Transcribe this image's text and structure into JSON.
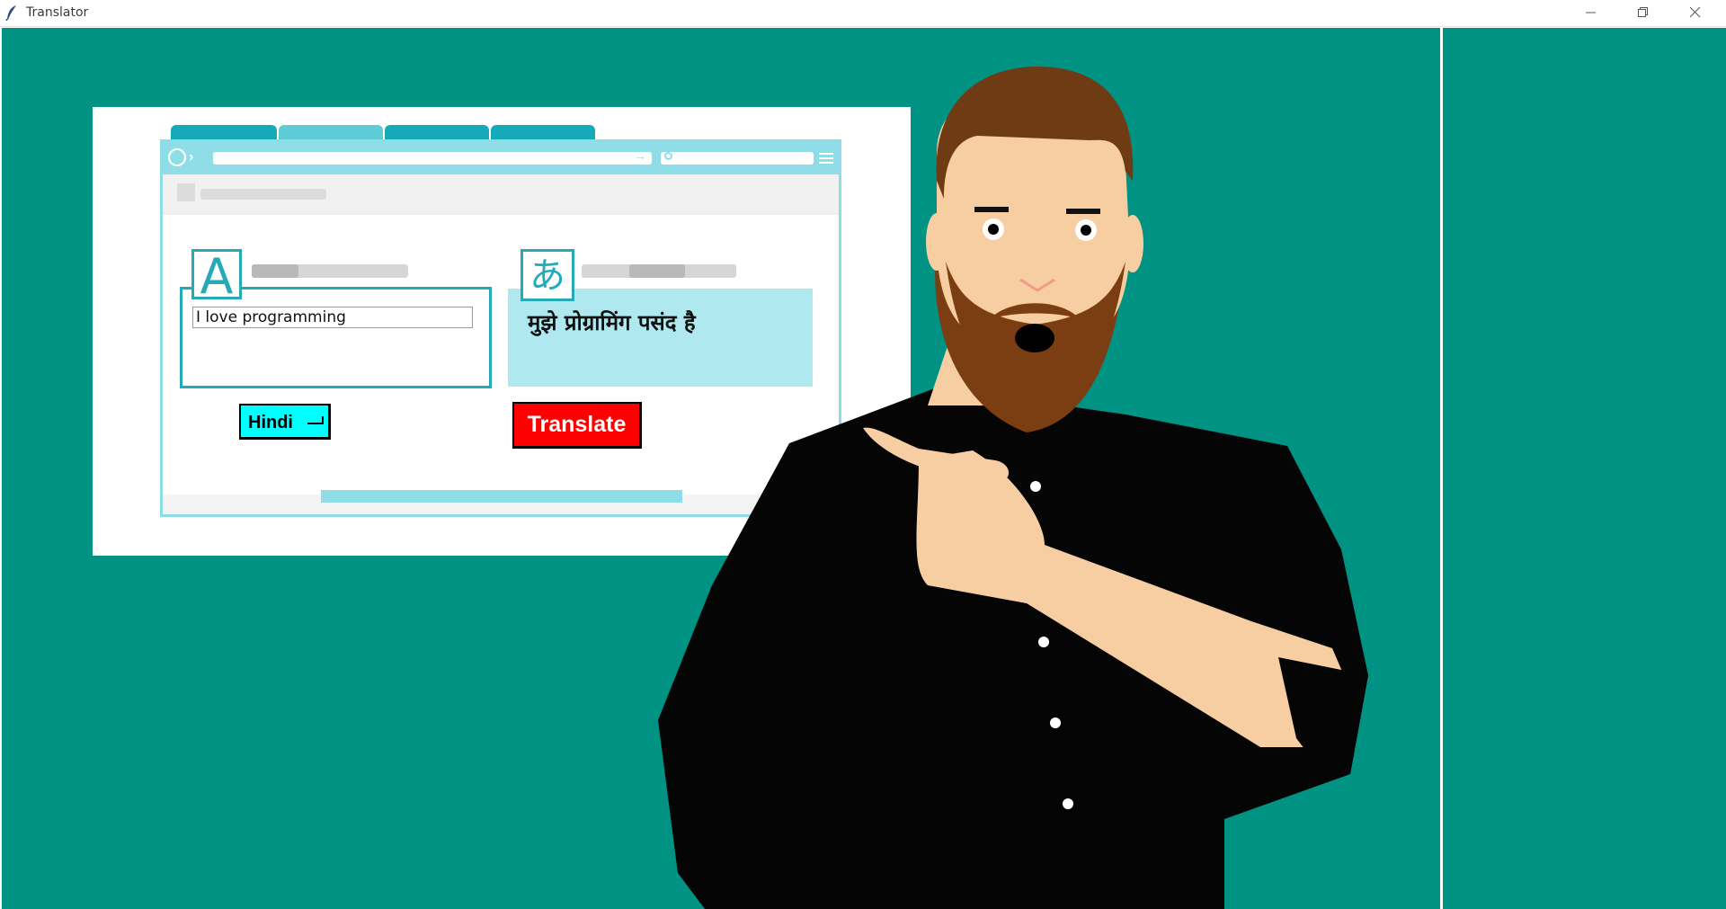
{
  "window": {
    "title": "Translator",
    "controls": [
      "minimize-icon",
      "restore-icon",
      "close-icon"
    ]
  },
  "translator": {
    "source_text": "I love programming",
    "target_text": "मुझे प्रोग्रामिंग पसंद है",
    "language_label": "Hindi",
    "translate_label": "Translate",
    "source_glyph": "A",
    "target_glyph": "あ"
  },
  "colors": {
    "background": "#009384",
    "language_button": "#00ffff",
    "translate_button": "#ff0000",
    "accent": "#27aab7",
    "target_panel": "#afe9ef"
  },
  "icons": {
    "app": "feather-icon",
    "character": "pointing-man-illustration"
  }
}
